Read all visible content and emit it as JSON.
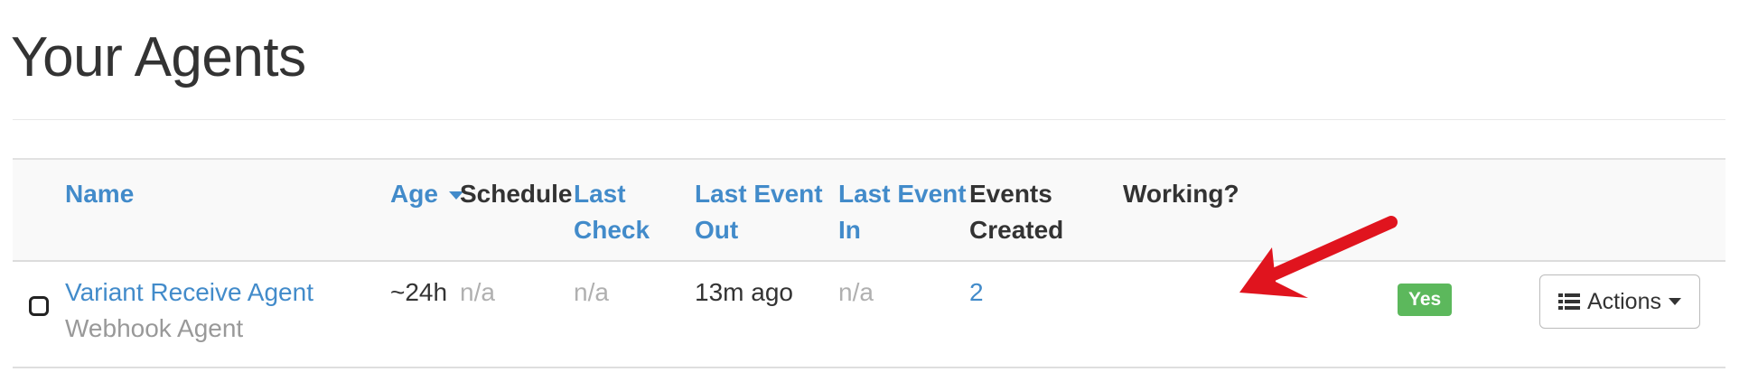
{
  "page": {
    "title": "Your Agents"
  },
  "table": {
    "headers": {
      "name": "Name",
      "age": "Age",
      "schedule": "Schedule",
      "last_check_1": "Last",
      "last_check_2": "Check",
      "last_event_out_1": "Last Event",
      "last_event_out_2": "Out",
      "last_event_in_1": "Last Event",
      "last_event_in_2": "In",
      "events_created_1": "Events",
      "events_created_2": "Created",
      "working": "Working?"
    },
    "rows": [
      {
        "name": "Variant Receive Agent",
        "type": "Webhook Agent",
        "age": "~24h",
        "schedule": "n/a",
        "last_check": "n/a",
        "last_event_out": "13m ago",
        "last_event_in": "n/a",
        "events_created": "2",
        "working": "Yes",
        "actions_label": "Actions"
      }
    ]
  },
  "icons": {
    "sort": "caret-down-icon",
    "actions": "list-icon",
    "actions_dropdown": "caret-down-icon",
    "row_select": "checkbox-icon",
    "annotation": "arrow-icon"
  },
  "colors": {
    "link": "#428bca",
    "success": "#5cb85c",
    "annotation_arrow": "#e0141e",
    "muted": "#b0b0b0"
  }
}
